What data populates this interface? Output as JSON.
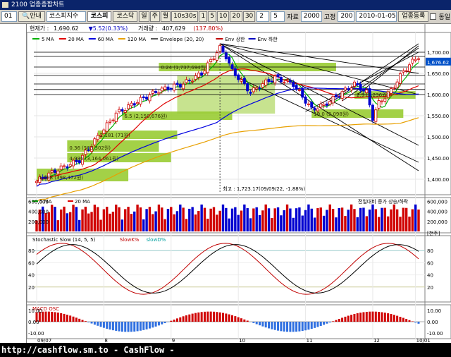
{
  "window": {
    "title": "2100 업종종합차트"
  },
  "toolbar": {
    "code": "01",
    "search_label": "안내",
    "index_select": "코스피지수",
    "kospi_tab": "코스피",
    "kosdaq_tab": "코스닥",
    "period_buttons": [
      "일",
      "주",
      "월",
      "10s30s",
      "1",
      "5",
      "10",
      "20",
      "30"
    ],
    "count_value": "2",
    "count2_value": "5",
    "data_label": "자료",
    "data_value": "2000",
    "fixed_label": "고정",
    "fixed_value": "200",
    "date_value": "2010-01-05",
    "register_button": "업종등록",
    "tile_checkbox_label": "동일"
  },
  "info": {
    "current_label": "현재가 :",
    "current_value": "1,690.62",
    "change": "▼5.52(0.33%)",
    "volume_label": "거래량 :",
    "volume_value": "407,629",
    "volume_change": "(137.80%)"
  },
  "legends": {
    "price": [
      "5 MA",
      "20 MA",
      "60 MA",
      "120 MA",
      "Envelope (20, 20)",
      "Env 상한",
      "Env 하한"
    ],
    "volume": [
      "5 MA",
      "20 MA"
    ],
    "volume_right": "전일대비 증가 상승/하락",
    "stochastic": [
      "Stochastic Slow (14, 5, 5)",
      "SlowK%",
      "slowD%"
    ],
    "macd": [
      "MACD OSC"
    ]
  },
  "colors": {
    "up": "#d00000",
    "down": "#0000d0",
    "ma5": "#00b000",
    "ma20": "#e00000",
    "ma60": "#0000e0",
    "ma120": "#e8a000",
    "env_box": "#99cc33",
    "bg": "#ffffff"
  },
  "annotations": {
    "high_note": "최고 : 1,723.17(09/09/22, -1.88%)",
    "price_badge": "1,676.62"
  },
  "boxes": [
    "1.698 (398,472원)",
    "4.986 (3,164,061원)",
    "0.36 (503,302원)",
    "2.181 (71원)",
    "6.5 (2,150,676원)",
    "0.24 (1,737,694원)",
    "19.0 (2,098원)",
    "2.9 (1,236원)"
  ],
  "axes": {
    "price_ticks": [
      "1,700.00",
      "1,650.00",
      "1,600.00",
      "1,550.00",
      "1,500.00",
      "1,450.00",
      "1,400.00"
    ],
    "volume_ticks": [
      "600,000",
      "400,000",
      "200,000",
      "[천주]"
    ],
    "stoch_ticks": [
      "80",
      "60",
      "40",
      "20"
    ],
    "macd_ticks": [
      "10.00",
      "0.00",
      "-10.00"
    ],
    "x_ticks": [
      "09/07",
      "8",
      "9",
      "10",
      "11",
      "12",
      "10/01"
    ]
  },
  "status": {
    "text": "http://cashflow.sm.to  - CashFlow -"
  }
}
